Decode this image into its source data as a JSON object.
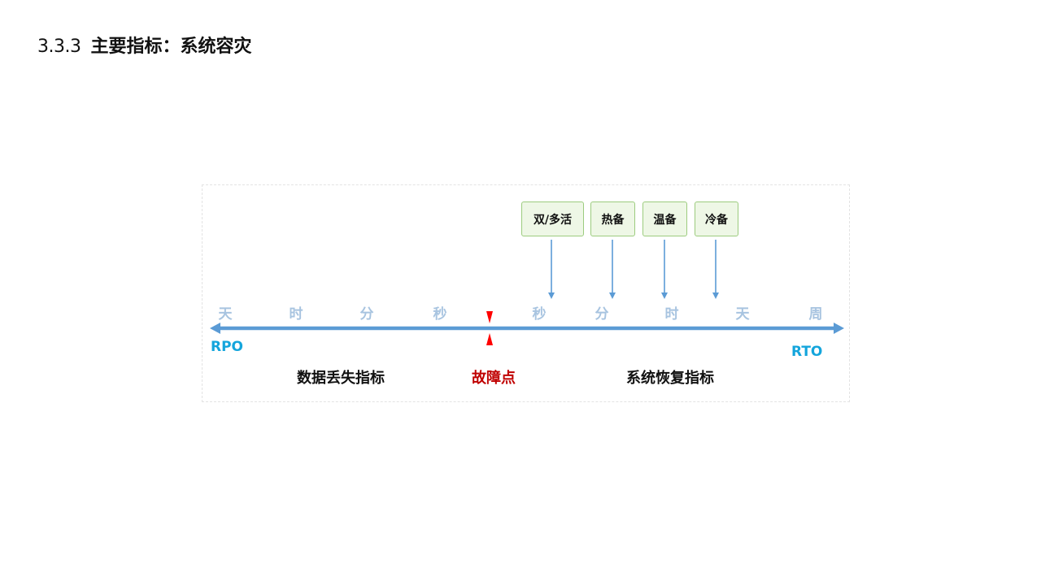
{
  "title": {
    "number": "3.3.3",
    "text": "主要指标：系统容灾"
  },
  "strategies": [
    {
      "label": "双/多活"
    },
    {
      "label": "热备"
    },
    {
      "label": "温备"
    },
    {
      "label": "冷备"
    }
  ],
  "rpo_ticks": [
    "天",
    "时",
    "分",
    "秒"
  ],
  "rto_ticks": [
    "秒",
    "分",
    "时",
    "天",
    "周"
  ],
  "rpo_label": "RPO",
  "rto_label": "RTO",
  "captions": {
    "data_loss": "数据丢失指标",
    "fault_point": "故障点",
    "recovery": "系统恢复指标"
  },
  "colors": {
    "axis": "#5b9bd5",
    "tick_text": "#a8c4e0",
    "box_fill": "#eef7e6",
    "box_border": "#9ccc7e",
    "fault_marker": "#ff0000",
    "fault_text": "#c00000",
    "rpo_rto_text": "#14a5dc"
  }
}
